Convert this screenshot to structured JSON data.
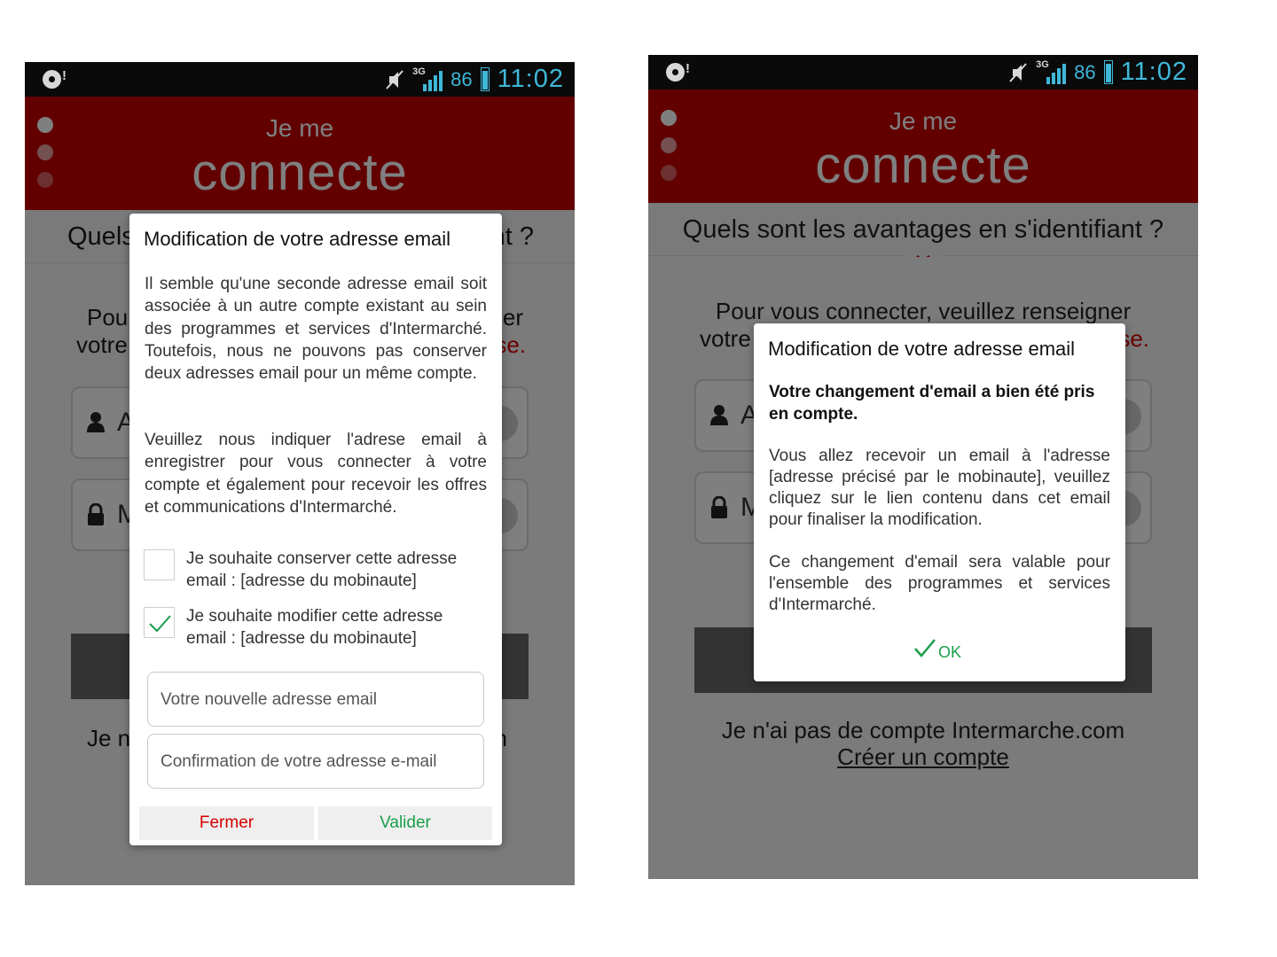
{
  "status_bar": {
    "battery_level": "86",
    "time": "11:02",
    "network": "3G",
    "icons": [
      "media-icon",
      "mute-icon",
      "signal-icon",
      "battery-icon"
    ]
  },
  "header": {
    "title_line1": "Je me",
    "title_line2": "connecte"
  },
  "advantages_bar": {
    "label": "Quels sont les avantages en s'identifiant ?"
  },
  "login": {
    "instruction_line1": "Pour vous connecter, veuillez renseigner",
    "instruction_line2_start": "votre",
    "instruction_line2_end": "se.",
    "field1_letter": "A",
    "field2_letter": "M",
    "no_account": "Je n'ai pas de compte Intermarche.com",
    "create_account": "Créer un compte",
    "peek_left1": "Pou",
    "peek_right1": "er",
    "peek_left2": "votre",
    "peek_right2": "se.",
    "peek_adv_left": "Quels",
    "peek_adv_right": "nt ?",
    "peek_no_account_left": "Je n",
    "peek_no_account_right": "n"
  },
  "dialog_edit": {
    "title": "Modification de votre adresse email",
    "paragraph1": "Il semble qu'une seconde adresse email soit associée à un autre compte existant au sein des programmes et services d'Intermarché. Toutefois, nous ne pouvons pas conserver deux adresses email pour un même compte.",
    "paragraph2": "Veuillez nous indiquer l'adrese email à enregistrer pour vous connecter à votre compte et également pour recevoir les offres et communications d'Intermarché.",
    "option_keep": "Je souhaite conserver cette adresse email : [adresse du mobinaute]",
    "option_keep_checked": false,
    "option_modify": "Je souhaite modifier cette adresse email : [adresse du mobinaute]",
    "option_modify_checked": true,
    "new_email_placeholder": "Votre nouvelle adresse email",
    "confirm_email_placeholder": "Confirmation de votre adresse e-mail",
    "close_label": "Fermer",
    "submit_label": "Valider"
  },
  "dialog_confirm": {
    "title": "Modification de votre adresse email",
    "headline": "Votre changement d'email a bien été pris en compte.",
    "paragraph1": "Vous allez recevoir un email à l'adresse [adresse précisé par le mobinaute], veuillez cliquez sur le lien contenu dans cet email pour finaliser la modification.",
    "paragraph2": "Ce changement d'email sera valable pour l'ensemble des programmes et services d'Intermarché.",
    "ok_label": "OK"
  },
  "colors": {
    "brand_red": "#c40000",
    "status_blue": "#3fb7d8",
    "close_red": "#d40000",
    "submit_green": "#1a9e4a"
  }
}
